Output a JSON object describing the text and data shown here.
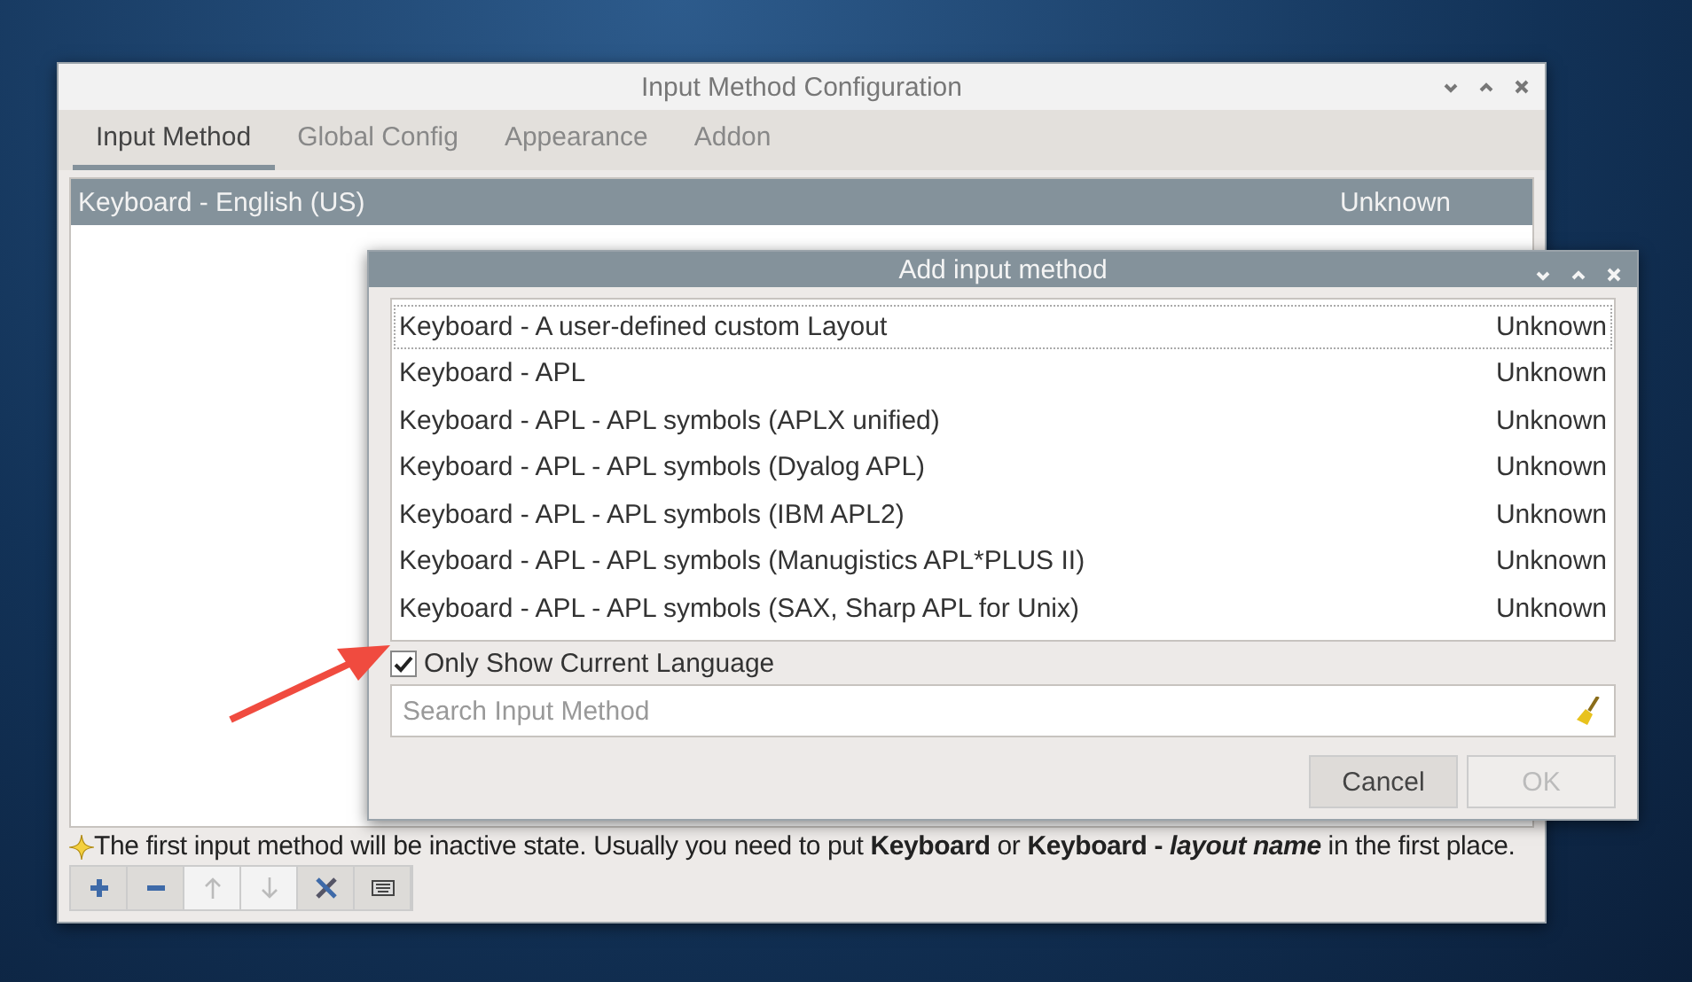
{
  "main_window": {
    "title": "Input Method Configuration",
    "tabs": [
      {
        "label": "Input Method",
        "selected": true
      },
      {
        "label": "Global Config",
        "selected": false
      },
      {
        "label": "Appearance",
        "selected": false
      },
      {
        "label": "Addon",
        "selected": false
      }
    ],
    "list": [
      {
        "name": "Keyboard - English (US)",
        "status": "Unknown",
        "selected": true
      }
    ],
    "hint": [
      {
        "text": "The first input method will be inactive state. Usually you need to put ",
        "kind": "plain"
      },
      {
        "text": "Keyboard",
        "kind": "bold"
      },
      {
        "text": " or ",
        "kind": "plain"
      },
      {
        "text": "Keyboard - ",
        "kind": "bold"
      },
      {
        "text": "layout name",
        "kind": "bold-italic"
      },
      {
        "text": " in the first place.",
        "kind": "plain"
      }
    ],
    "toolbar": [
      {
        "kind": "add",
        "disabled": false
      },
      {
        "kind": "remove",
        "disabled": false
      },
      {
        "kind": "up",
        "disabled": true
      },
      {
        "kind": "down",
        "disabled": true
      },
      {
        "kind": "configure",
        "disabled": false
      },
      {
        "kind": "keyboard",
        "disabled": false
      }
    ]
  },
  "dialog": {
    "title": "Add input method",
    "list": [
      {
        "name": "Keyboard - A user-defined custom Layout",
        "status": "Unknown",
        "focused": true
      },
      {
        "name": "Keyboard - APL",
        "status": "Unknown",
        "focused": false
      },
      {
        "name": "Keyboard - APL - APL symbols (APLX unified)",
        "status": "Unknown",
        "focused": false
      },
      {
        "name": "Keyboard - APL - APL symbols (Dyalog APL)",
        "status": "Unknown",
        "focused": false
      },
      {
        "name": "Keyboard - APL - APL symbols (IBM APL2)",
        "status": "Unknown",
        "focused": false
      },
      {
        "name": "Keyboard - APL - APL symbols (Manugistics APL*PLUS II)",
        "status": "Unknown",
        "focused": false
      },
      {
        "name": "Keyboard - APL - APL symbols (SAX, Sharp APL for Unix)",
        "status": "Unknown",
        "focused": false
      }
    ],
    "only_current_language": {
      "label": "Only Show Current Language",
      "checked": true
    },
    "search": {
      "placeholder": "Search Input Method"
    },
    "buttons": [
      {
        "label": "Cancel",
        "disabled": false
      },
      {
        "label": "OK",
        "disabled": true
      }
    ]
  }
}
